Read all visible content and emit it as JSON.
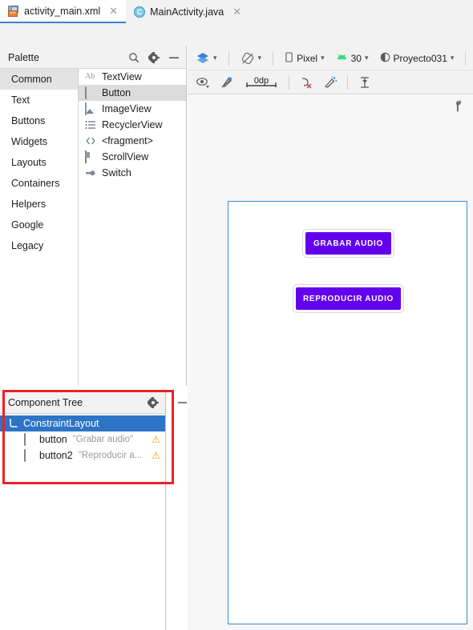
{
  "tabs": [
    {
      "label": "activity_main.xml",
      "icon": "xml-layout-icon",
      "active": true,
      "tag": "<>"
    },
    {
      "label": "MainActivity.java",
      "icon": "java-class-icon",
      "active": false,
      "letter": "C"
    }
  ],
  "palette": {
    "title": "Palette",
    "icons": {
      "search": "search-icon",
      "gear": "gear-icon",
      "minimize": "minimize-icon"
    },
    "categories": [
      {
        "label": "Common",
        "selected": true
      },
      {
        "label": "Text",
        "selected": false
      },
      {
        "label": "Buttons",
        "selected": false
      },
      {
        "label": "Widgets",
        "selected": false
      },
      {
        "label": "Layouts",
        "selected": false
      },
      {
        "label": "Containers",
        "selected": false
      },
      {
        "label": "Helpers",
        "selected": false
      },
      {
        "label": "Google",
        "selected": false
      },
      {
        "label": "Legacy",
        "selected": false
      }
    ],
    "items": [
      {
        "label": "TextView",
        "icon": "textview-icon",
        "selected": false
      },
      {
        "label": "Button",
        "icon": "button-icon",
        "selected": true
      },
      {
        "label": "ImageView",
        "icon": "imageview-icon",
        "selected": false
      },
      {
        "label": "RecyclerView",
        "icon": "recyclerview-icon",
        "selected": false
      },
      {
        "label": "<fragment>",
        "icon": "fragment-icon",
        "selected": false
      },
      {
        "label": "ScrollView",
        "icon": "scrollview-icon",
        "selected": false
      },
      {
        "label": "Switch",
        "icon": "switch-icon",
        "selected": false
      }
    ]
  },
  "component_tree": {
    "title": "Component Tree",
    "icons": {
      "gear": "gear-icon",
      "minimize": "minimize-icon"
    },
    "highlight_color": "#e8232a",
    "rows": [
      {
        "name": "ConstraintLayout",
        "value": "",
        "icon": "constraintlayout-icon",
        "selected": true,
        "warning": false,
        "depth": 0
      },
      {
        "name": "button",
        "value": "\"Grabar audio\"",
        "icon": "button-icon",
        "selected": false,
        "warning": true,
        "depth": 1
      },
      {
        "name": "button2",
        "value": "\"Reproducir a...",
        "icon": "button-icon",
        "selected": false,
        "warning": true,
        "depth": 1
      }
    ]
  },
  "toolbar_row1": {
    "layers_icon": "design-modes-icon",
    "blueprint_icon": "orientation-icon",
    "device": {
      "label": "Pixel",
      "icon": "phone-icon"
    },
    "api": {
      "label": "30",
      "icon": "android-icon"
    },
    "theme": {
      "label": "Proyecto031",
      "icon": "theme-icon"
    }
  },
  "toolbar_row2": {
    "items": [
      {
        "name": "view-options-icon",
        "label": ""
      },
      {
        "name": "toggle-autoconnect-icon",
        "label": ""
      },
      {
        "name": "default-margin-value",
        "label": "0dp"
      },
      {
        "name": "clear-constraints-icon",
        "label": ""
      },
      {
        "name": "infer-constraints-icon",
        "label": ""
      },
      {
        "name": "guidelines-icon",
        "label": ""
      }
    ],
    "margin_value": "0dp"
  },
  "canvas": {
    "wrench_icon": "render-settings-icon",
    "frame_border_color": "#3a8ad6",
    "buttons": [
      {
        "id": "btn-grabar",
        "label": "GRABAR AUDIO",
        "color": "#6200ee"
      },
      {
        "id": "btn-reproducir",
        "label": "REPRODUCIR AUDIO",
        "color": "#6200ee"
      }
    ]
  }
}
